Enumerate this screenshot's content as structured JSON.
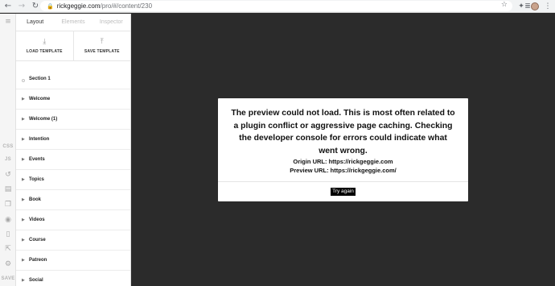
{
  "browser": {
    "url_host": "rickgeggie.com",
    "url_path": "/pro/#/content/230",
    "icons": {
      "back": "arrow-left-icon",
      "forward": "arrow-right-icon",
      "reload": "reload-icon",
      "lock": "lock-icon",
      "star": "star-icon",
      "extensions": "puzzle-icon",
      "reading": "reading-list-icon",
      "profile": "avatar",
      "menu": "kebab-menu-icon"
    }
  },
  "rail": {
    "css_label": "CSS",
    "js_label": "JS",
    "save_label": "SAVE"
  },
  "panel": {
    "tabs": [
      {
        "label": "Layout",
        "active": true
      },
      {
        "label": "Elements",
        "active": false
      },
      {
        "label": "Inspector",
        "active": false
      }
    ],
    "load_template": "LOAD TEMPLATE",
    "save_template": "SAVE TEMPLATE",
    "sections": [
      {
        "label": "Section 1",
        "kind": "circle"
      },
      {
        "label": "Welcome",
        "kind": "caret"
      },
      {
        "label": "Welcome (1)",
        "kind": "caret"
      },
      {
        "label": "Intention",
        "kind": "caret"
      },
      {
        "label": "Events",
        "kind": "caret"
      },
      {
        "label": "Topics",
        "kind": "caret"
      },
      {
        "label": "Book",
        "kind": "caret"
      },
      {
        "label": "Videos",
        "kind": "caret"
      },
      {
        "label": "Course",
        "kind": "caret"
      },
      {
        "label": "Patreon",
        "kind": "caret"
      },
      {
        "label": "Social",
        "kind": "caret"
      }
    ]
  },
  "modal": {
    "message": "The preview could not load. This is most often related to a plugin conflict or aggressive page caching. Checking the developer console for errors could indicate what went wrong.",
    "origin_url": "Origin URL: https://rickgeggie.com",
    "preview_url": "Preview URL: https://rickgeggie.com/",
    "try_again": "Try again"
  }
}
